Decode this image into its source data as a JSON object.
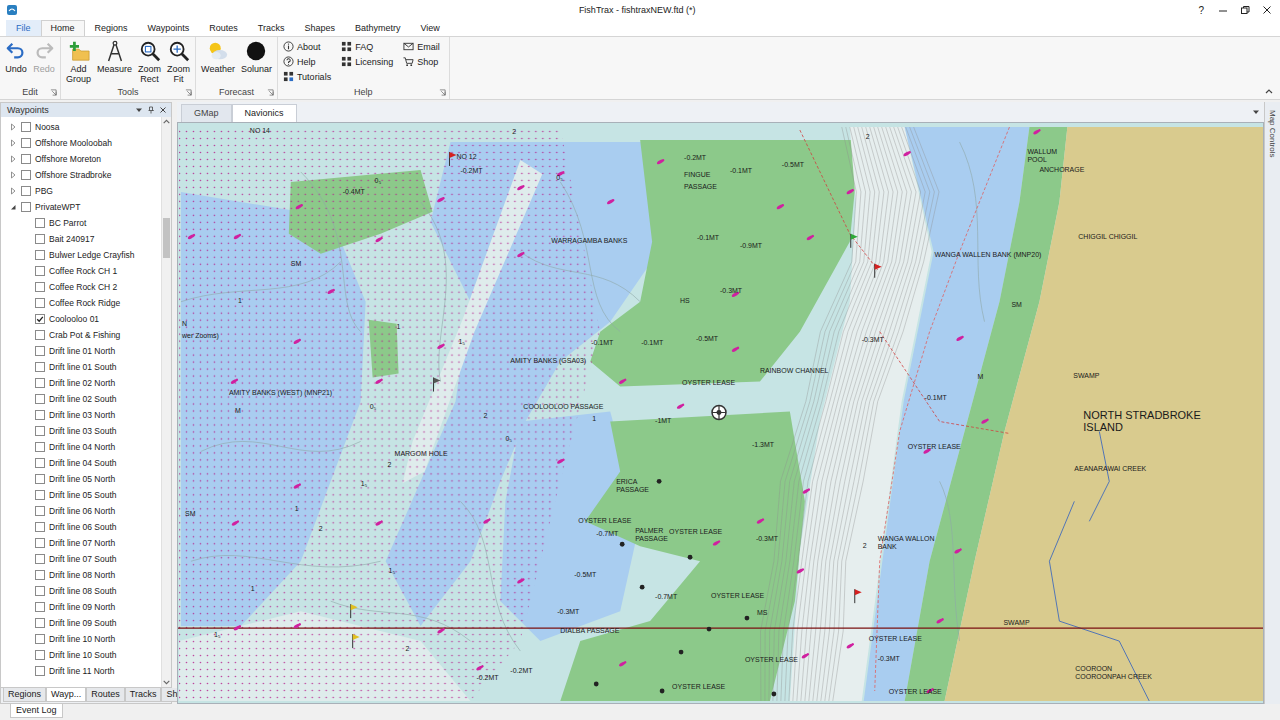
{
  "window": {
    "title": "FishTrax - fishtraxNEW.ftd (*)",
    "help": "?"
  },
  "ribbon_tabs": [
    {
      "label": "File",
      "kind": "menu",
      "selected": false
    },
    {
      "label": "Home",
      "kind": "tab",
      "selected": true
    },
    {
      "label": "Regions",
      "kind": "tab",
      "selected": false
    },
    {
      "label": "Waypoints",
      "kind": "tab",
      "selected": false
    },
    {
      "label": "Routes",
      "kind": "tab",
      "selected": false
    },
    {
      "label": "Tracks",
      "kind": "tab",
      "selected": false
    },
    {
      "label": "Shapes",
      "kind": "tab",
      "selected": false
    },
    {
      "label": "Bathymetry",
      "kind": "tab",
      "selected": false
    },
    {
      "label": "View",
      "kind": "tab",
      "selected": false
    }
  ],
  "ribbon_groups": [
    {
      "label": "Edit",
      "large": [
        {
          "lines": [
            "Undo"
          ],
          "disabled": false
        },
        {
          "lines": [
            "Redo"
          ],
          "disabled": true
        }
      ],
      "small_columns": []
    },
    {
      "label": "Tools",
      "large": [
        {
          "lines": [
            "Add",
            "Group"
          ],
          "disabled": false
        },
        {
          "lines": [
            "Measure"
          ],
          "disabled": false
        },
        {
          "lines": [
            "Zoom",
            "Rect"
          ],
          "disabled": false
        },
        {
          "lines": [
            "Zoom",
            "Fit"
          ],
          "disabled": false
        }
      ],
      "small_columns": []
    },
    {
      "label": "Forecast",
      "large": [
        {
          "lines": [
            "Weather"
          ],
          "disabled": false
        },
        {
          "lines": [
            "Solunar"
          ],
          "disabled": false
        }
      ],
      "small_columns": []
    },
    {
      "label": "Help",
      "large": [],
      "small_columns": [
        [
          {
            "label": "About"
          },
          {
            "label": "Help"
          },
          {
            "label": "Tutorials"
          }
        ],
        [
          {
            "label": "FAQ"
          },
          {
            "label": "Licensing"
          }
        ],
        [
          {
            "label": "Email"
          },
          {
            "label": "Shop"
          }
        ]
      ]
    }
  ],
  "sidebar": {
    "title": "Waypoints",
    "items": [
      {
        "label": "Noosa",
        "depth": 0,
        "expandable": true,
        "expanded": false,
        "checked": false
      },
      {
        "label": "Offshore Mooloobah",
        "depth": 0,
        "expandable": true,
        "expanded": false,
        "checked": false
      },
      {
        "label": "Offshore Moreton",
        "depth": 0,
        "expandable": true,
        "expanded": false,
        "checked": false
      },
      {
        "label": "Offshore Stradbroke",
        "depth": 0,
        "expandable": true,
        "expanded": false,
        "checked": false
      },
      {
        "label": "PBG",
        "depth": 0,
        "expandable": true,
        "expanded": false,
        "checked": false
      },
      {
        "label": "PrivateWPT",
        "depth": 0,
        "expandable": true,
        "expanded": true,
        "checked": false
      },
      {
        "label": "BC Parrot",
        "depth": 1,
        "expandable": false,
        "expanded": false,
        "checked": false
      },
      {
        "label": "Bait 240917",
        "depth": 1,
        "expandable": false,
        "expanded": false,
        "checked": false
      },
      {
        "label": "Bulwer Ledge Crayfish",
        "depth": 1,
        "expandable": false,
        "expanded": false,
        "checked": false
      },
      {
        "label": "Coffee Rock CH 1",
        "depth": 1,
        "expandable": false,
        "expanded": false,
        "checked": false
      },
      {
        "label": "Coffee Rock CH 2",
        "depth": 1,
        "expandable": false,
        "expanded": false,
        "checked": false
      },
      {
        "label": "Coffee Rock Ridge",
        "depth": 1,
        "expandable": false,
        "expanded": false,
        "checked": false
      },
      {
        "label": "Coolooloo 01",
        "depth": 1,
        "expandable": false,
        "expanded": false,
        "checked": true
      },
      {
        "label": "Crab Pot & Fishing",
        "depth": 1,
        "expandable": false,
        "expanded": false,
        "checked": false
      },
      {
        "label": "Drift line 01 North",
        "depth": 1,
        "expandable": false,
        "expanded": false,
        "checked": false
      },
      {
        "label": "Drift line 01 South",
        "depth": 1,
        "expandable": false,
        "expanded": false,
        "checked": false
      },
      {
        "label": "Drift line 02 North",
        "depth": 1,
        "expandable": false,
        "expanded": false,
        "checked": false
      },
      {
        "label": "Drift line 02 South",
        "depth": 1,
        "expandable": false,
        "expanded": false,
        "checked": false
      },
      {
        "label": "Drift line 03 North",
        "depth": 1,
        "expandable": false,
        "expanded": false,
        "checked": false
      },
      {
        "label": "Drift line 03 South",
        "depth": 1,
        "expandable": false,
        "expanded": false,
        "checked": false
      },
      {
        "label": "Drift line 04 North",
        "depth": 1,
        "expandable": false,
        "expanded": false,
        "checked": false
      },
      {
        "label": "Drift line 04 South",
        "depth": 1,
        "expandable": false,
        "expanded": false,
        "checked": false
      },
      {
        "label": "Drift line 05 North",
        "depth": 1,
        "expandable": false,
        "expanded": false,
        "checked": false
      },
      {
        "label": "Drift line 05 South",
        "depth": 1,
        "expandable": false,
        "expanded": false,
        "checked": false
      },
      {
        "label": "Drift line 06 North",
        "depth": 1,
        "expandable": false,
        "expanded": false,
        "checked": false
      },
      {
        "label": "Drift line 06 South",
        "depth": 1,
        "expandable": false,
        "expanded": false,
        "checked": false
      },
      {
        "label": "Drift line 07 North",
        "depth": 1,
        "expandable": false,
        "expanded": false,
        "checked": false
      },
      {
        "label": "Drift line 07 South",
        "depth": 1,
        "expandable": false,
        "expanded": false,
        "checked": false
      },
      {
        "label": "Drift line 08 North",
        "depth": 1,
        "expandable": false,
        "expanded": false,
        "checked": false
      },
      {
        "label": "Drift line 08 South",
        "depth": 1,
        "expandable": false,
        "expanded": false,
        "checked": false
      },
      {
        "label": "Drift line 09 North",
        "depth": 1,
        "expandable": false,
        "expanded": false,
        "checked": false
      },
      {
        "label": "Drift line 09 South",
        "depth": 1,
        "expandable": false,
        "expanded": false,
        "checked": false
      },
      {
        "label": "Drift line 10 North",
        "depth": 1,
        "expandable": false,
        "expanded": false,
        "checked": false
      },
      {
        "label": "Drift line 10 South",
        "depth": 1,
        "expandable": false,
        "expanded": false,
        "checked": false
      },
      {
        "label": "Drift line 11 North",
        "depth": 1,
        "expandable": false,
        "expanded": false,
        "checked": false
      }
    ],
    "tabs": [
      {
        "label": "Regions",
        "selected": false
      },
      {
        "label": "Wayp...",
        "selected": true
      },
      {
        "label": "Routes",
        "selected": false
      },
      {
        "label": "Tracks",
        "selected": false
      },
      {
        "label": "Shapes",
        "selected": false
      }
    ]
  },
  "map": {
    "tabs": [
      {
        "label": "GMap",
        "selected": false
      },
      {
        "label": "Navionics",
        "selected": true
      }
    ],
    "controls_label": "Map Controls",
    "labels": [
      {
        "text": "NO 14"
      },
      {
        "text": "NO 12"
      },
      {
        "text": "-0.2MT"
      },
      {
        "text": "-0.4MT"
      },
      {
        "text": "-0.2MT"
      },
      {
        "text": "FINGUE"
      },
      {
        "text": "PASSAGE"
      },
      {
        "text": "-0.1MT"
      },
      {
        "text": "-0.5MT"
      },
      {
        "text": "WALLUM"
      },
      {
        "text": "POOL"
      },
      {
        "text": "ANCHORAGE"
      },
      {
        "text": "CHIGGIL CHIGGIL"
      },
      {
        "text": "WARRAGAMBA BANKS"
      },
      {
        "text": "-0.1MT"
      },
      {
        "text": "-0.9MT"
      },
      {
        "text": "WANGA WALLEN BANK (MNP20)"
      },
      {
        "text": "-0.3MT"
      },
      {
        "text": "SM"
      },
      {
        "text": "SM"
      },
      {
        "text": "-0.1MT"
      },
      {
        "text": "-0.1MT"
      },
      {
        "text": "-0.5MT"
      },
      {
        "text": "-0.3MT"
      },
      {
        "text": "AMITY BANKS (GSA03)"
      },
      {
        "text": "RAINBOW CHANNEL"
      },
      {
        "text": "SWAMP"
      },
      {
        "text": "M"
      },
      {
        "text": "OYSTER LEASE"
      },
      {
        "text": "AMITY BANKS (WEST) (MNP21)"
      },
      {
        "text": "-0.1MT"
      },
      {
        "text": "NORTH STRADBROKE"
      },
      {
        "text": "ISLAND"
      },
      {
        "text": "COOLOOLOO PASSAGE"
      },
      {
        "text": "-1MT"
      },
      {
        "text": "OYSTER LEASE"
      },
      {
        "text": "-1.3MT"
      },
      {
        "text": "MARGOM HOLE"
      },
      {
        "text": "AEANARAWAI CREEK"
      },
      {
        "text": "ERICA"
      },
      {
        "text": "PASSAGE"
      },
      {
        "text": "OYSTER LEASE"
      },
      {
        "text": "PALMER"
      },
      {
        "text": "PASSAGE"
      },
      {
        "text": "OYSTER LEASE"
      },
      {
        "text": "-0.7MT"
      },
      {
        "text": "-0.3MT"
      },
      {
        "text": "WANGA WALLON"
      },
      {
        "text": "BANK"
      },
      {
        "text": "-0.5MT"
      },
      {
        "text": "-0.7MT"
      },
      {
        "text": "OYSTER LEASE"
      },
      {
        "text": "-0.3MT"
      },
      {
        "text": "MS"
      },
      {
        "text": "SWAMP"
      },
      {
        "text": "DIALBA PASSAGE"
      },
      {
        "text": "OYSTER LEASE"
      },
      {
        "text": "-0.3MT"
      },
      {
        "text": "OYSTER LEASE"
      },
      {
        "text": "-0.2MT"
      },
      {
        "text": "-0.2MT"
      },
      {
        "text": "COOROON"
      },
      {
        "text": "COOROONPAH CREEK"
      },
      {
        "text": "OYSTER LEASE"
      },
      {
        "text": "OYSTER LEASE"
      },
      {
        "text": "N"
      },
      {
        "text": "wer Zooms)"
      },
      {
        "text": "M"
      },
      {
        "text": "SM"
      },
      {
        "text": "HS"
      },
      {
        "text": "2"
      },
      {
        "text": "0₅"
      },
      {
        "text": "1"
      },
      {
        "text": "1₅"
      },
      {
        "text": "2"
      },
      {
        "text": "2"
      },
      {
        "text": "1"
      },
      {
        "text": "2"
      },
      {
        "text": "1₅"
      },
      {
        "text": "0₅"
      },
      {
        "text": "1"
      },
      {
        "text": "1₅"
      },
      {
        "text": "2"
      },
      {
        "text": "2"
      },
      {
        "text": "1"
      },
      {
        "text": "0₅"
      },
      {
        "text": "1₅"
      },
      {
        "text": "2"
      },
      {
        "text": "0₅"
      },
      {
        "text": "1"
      }
    ]
  },
  "event_log": "Event Log"
}
